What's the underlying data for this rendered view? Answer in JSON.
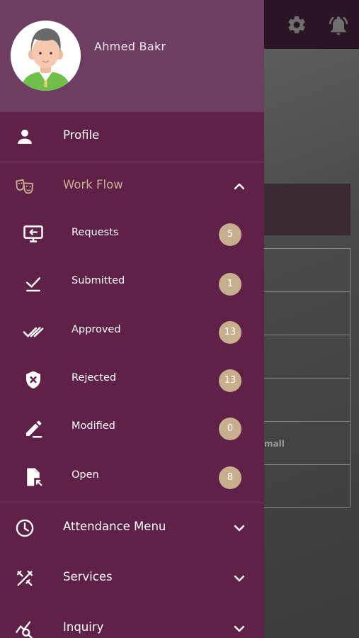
{
  "user": {
    "name": "Ahmed Bakr"
  },
  "menu": {
    "profile_label": "Profile",
    "workflow_label": "Work Flow",
    "workflow_items": [
      {
        "label": "Requests",
        "count": "5",
        "icon": "monitor-arrow-icon"
      },
      {
        "label": "Submitted",
        "count": "1",
        "icon": "check-underline-icon"
      },
      {
        "label": "Approved",
        "count": "13",
        "icon": "double-check-icon"
      },
      {
        "label": "Rejected",
        "count": "13",
        "icon": "shield-x-icon"
      },
      {
        "label": "Modified",
        "count": "0",
        "icon": "pencil-icon"
      },
      {
        "label": "Open",
        "count": "8",
        "icon": "document-open-icon"
      }
    ],
    "attendance_label": "Attendance Menu",
    "services_label": "Services",
    "inquiry_label": "Inquiry"
  },
  "background": {
    "small_text": "mall"
  },
  "colors": {
    "drawer_bg": "#5f2148",
    "drawer_header_bg": "#6d3d62",
    "accent_gold": "#c7ae8d",
    "text": "#ffffff"
  }
}
